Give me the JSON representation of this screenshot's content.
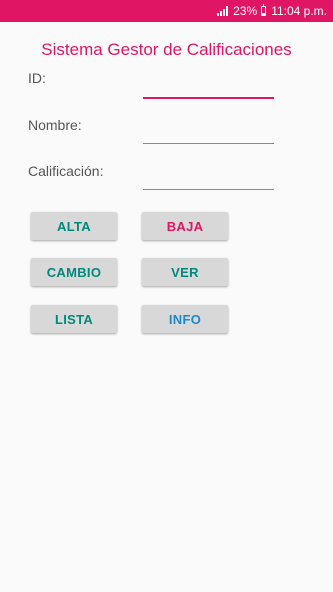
{
  "status_bar": {
    "battery": "23%",
    "time": "11:04 p.m."
  },
  "app": {
    "title": "Sistema Gestor de Calificaciones"
  },
  "form": {
    "id_label": "ID:",
    "id_value": "",
    "nombre_label": "Nombre:",
    "nombre_value": "",
    "calificacion_label": "Calificación:",
    "calificacion_value": ""
  },
  "buttons": {
    "alta": "ALTA",
    "baja": "BAJA",
    "cambio": "CAMBIO",
    "ver": "VER",
    "lista": "LISTA",
    "info": "INFO"
  },
  "colors": {
    "accent": "#e01563",
    "teal": "#00897b",
    "blue": "#1e88c8",
    "button_bg": "#d8d8d8"
  }
}
